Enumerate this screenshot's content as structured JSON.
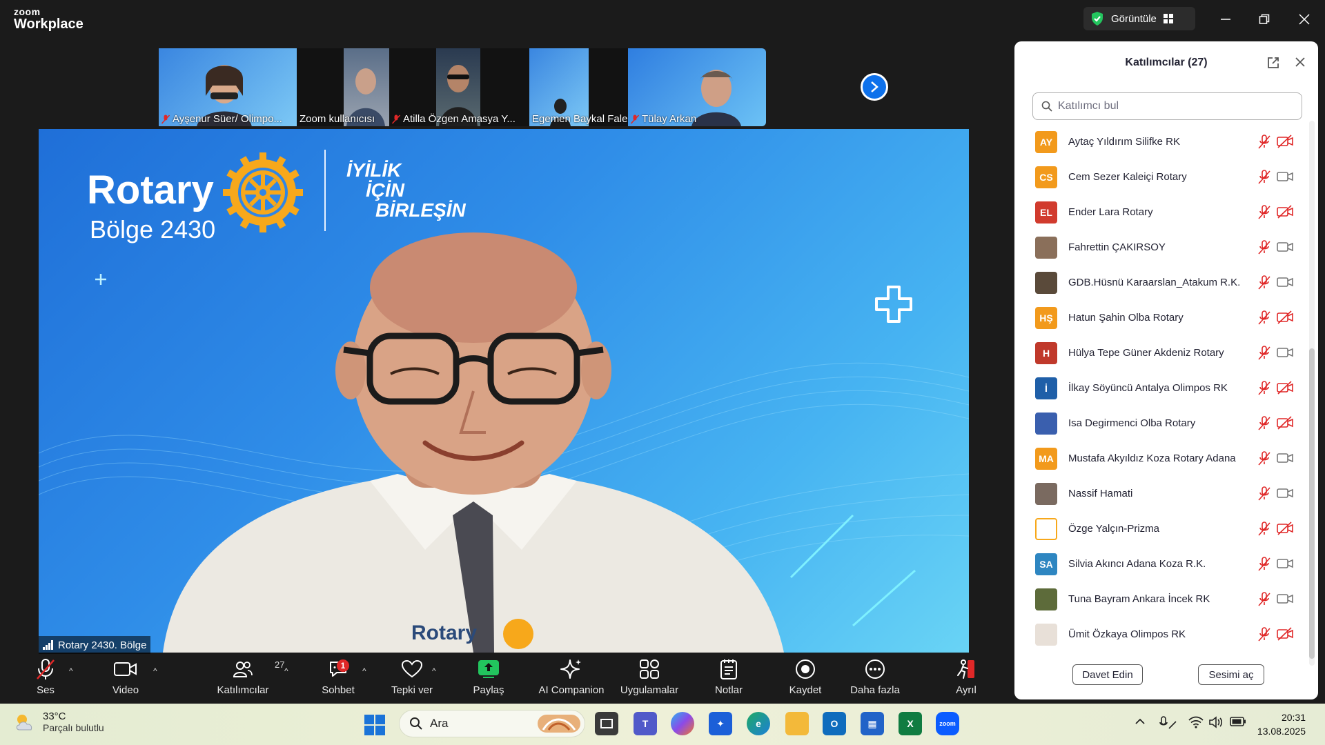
{
  "app": {
    "brand_top": "zoom",
    "brand_bottom": "Workplace",
    "view_label": "Görüntüle"
  },
  "thumbnails": [
    {
      "name": "Ayşenur Süer/ Olimpo...",
      "muted": true
    },
    {
      "name": "Zoom kullanıcısı",
      "muted": false
    },
    {
      "name": "Atilla Özgen Amasya Y...",
      "muted": true
    },
    {
      "name": "Egemen Baykal Falez Rota...",
      "muted": false
    },
    {
      "name": "Tülay Arkan",
      "muted": true
    }
  ],
  "main": {
    "logo_word": "Rotary",
    "district": "Bölge 2430",
    "slogan": [
      "İYİLİK",
      "İÇİN",
      "BİRLEŞİN"
    ],
    "shirt_text": "Rotary",
    "speaker_label": "Rotary 2430. Bölge"
  },
  "toolbar": {
    "audio": "Ses",
    "video": "Video",
    "participants": "Katılımcılar",
    "participants_count": "27",
    "chat": "Sohbet",
    "chat_badge": "1",
    "react": "Tepki ver",
    "share": "Paylaş",
    "ai": "AI Companion",
    "apps": "Uygulamalar",
    "notes": "Notlar",
    "record": "Kaydet",
    "more": "Daha fazla",
    "leave": "Ayrıl"
  },
  "panel": {
    "title": "Katılımcılar (27)",
    "search_placeholder": "Katılımcı bul",
    "invite": "Davet Edin",
    "unmute": "Sesimi aç",
    "participants": [
      {
        "initials": "AY",
        "name": "Aytaç Yıldırım Silifke RK",
        "color": "#f29a1c",
        "cam_off": true
      },
      {
        "initials": "CS",
        "name": "Cem Sezer Kaleiçi Rotary",
        "color": "#f29a1c",
        "cam_off": false
      },
      {
        "initials": "EL",
        "name": "Ender Lara Rotary",
        "color": "#d13b2e",
        "cam_off": true
      },
      {
        "initials": "",
        "name": "Fahrettin ÇAKIRSOY",
        "color": "#8a6f5a",
        "cam_off": false
      },
      {
        "initials": "",
        "name": "GDB.Hüsnü Karaarslan_Atakum R.K.",
        "color": "#5a4a3a",
        "cam_off": false
      },
      {
        "initials": "HŞ",
        "name": "Hatun Şahin Olba Rotary",
        "color": "#f29a1c",
        "cam_off": true
      },
      {
        "initials": "H",
        "name": "Hülya Tepe Güner Akdeniz Rotary",
        "color": "#c0392b",
        "cam_off": false
      },
      {
        "initials": "İ",
        "name": "İlkay Söyüncü Antalya Olimpos RK",
        "color": "#1f5fa8",
        "cam_off": true
      },
      {
        "initials": "",
        "name": "Isa Degirmenci Olba Rotary",
        "color": "#3a5fae",
        "cam_off": true
      },
      {
        "initials": "MA",
        "name": "Mustafa Akyıldız Koza  Rotary Adana",
        "color": "#f29a1c",
        "cam_off": false
      },
      {
        "initials": "",
        "name": "Nassif Hamati",
        "color": "#7a6a60",
        "cam_off": false
      },
      {
        "initials": "",
        "name": "Özge Yalçın-Prizma",
        "color": "#ffffff",
        "cam_off": true
      },
      {
        "initials": "SA",
        "name": "Silvia Akıncı Adana Koza R.K.",
        "color": "#2e86c1",
        "cam_off": false
      },
      {
        "initials": "",
        "name": "Tuna Bayram Ankara İncek RK",
        "color": "#5d6b3a",
        "cam_off": false
      },
      {
        "initials": "",
        "name": "Ümit Özkaya Olimpos RK",
        "color": "#e8e0d8",
        "cam_off": true
      }
    ]
  },
  "taskbar": {
    "temp": "33°C",
    "weather": "Parçalı bulutlu",
    "search": "Ara",
    "time": "20:31",
    "date": "13.08.2025"
  },
  "colors": {
    "accent": "#0e71eb",
    "muted_red": "#e02828",
    "share_green": "#22c55e"
  }
}
